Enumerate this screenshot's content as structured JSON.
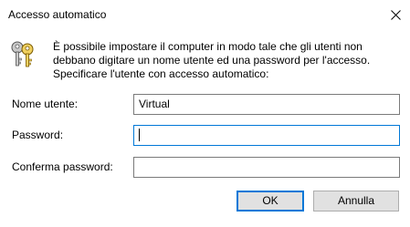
{
  "window": {
    "title": "Accesso automatico",
    "close_icon": "close-icon"
  },
  "icon": "keys-icon",
  "description": {
    "lines": [
      "È possibile impostare il computer in modo tale che gli utenti non",
      "debbano digitare un nome utente ed una password per l'accesso.",
      "Specificare l'utente con accesso automatico:"
    ]
  },
  "fields": {
    "username": {
      "label": "Nome utente:",
      "value": "Virtual"
    },
    "password": {
      "label": "Password:",
      "value": ""
    },
    "confirm_password": {
      "label": "Conferma password:",
      "value": ""
    }
  },
  "buttons": {
    "ok": "OK",
    "cancel": "Annulla"
  },
  "colors": {
    "focus_border": "#0078d7",
    "button_face": "#e1e1e1",
    "field_border": "#7a7a7a"
  }
}
